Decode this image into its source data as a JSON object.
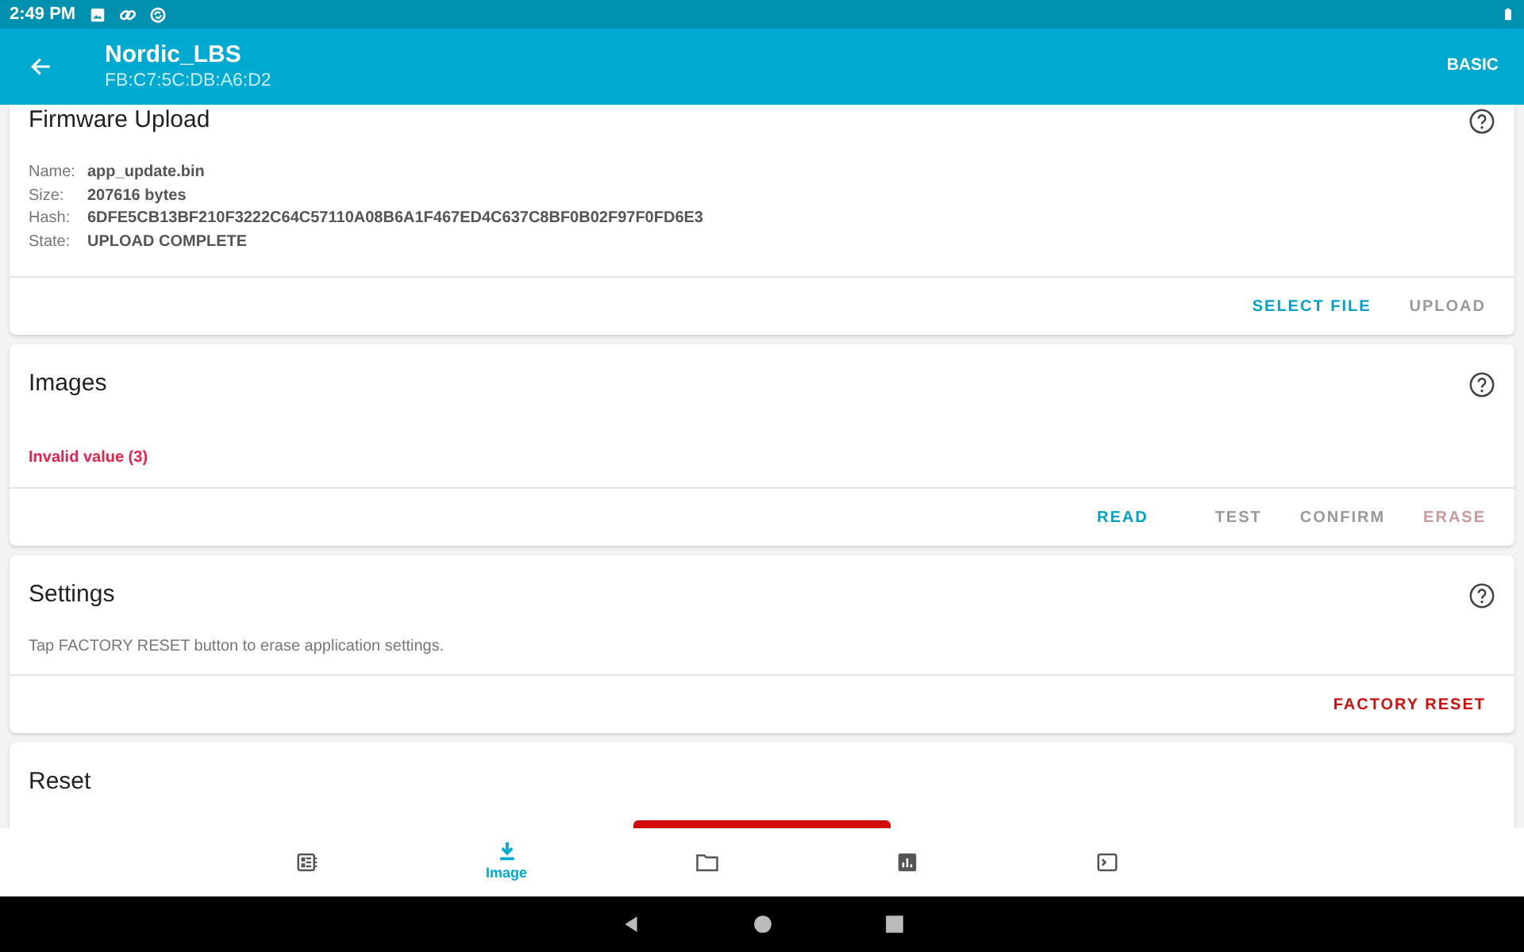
{
  "status_bar": {
    "time": "2:49 PM"
  },
  "app_bar": {
    "title": "Nordic_LBS",
    "subtitle": "FB:C7:5C:DB:A6:D2",
    "action": "BASIC"
  },
  "cards": [
    {
      "title": "Firmware Upload",
      "help": true,
      "fields": [
        {
          "label": "Name:",
          "value": "app_update.bin"
        },
        {
          "label": "Size:",
          "value": "207616 bytes"
        },
        {
          "label": "Hash:",
          "value": "6DFE5CB13BF210F3222C64C57110A08B6A1F467ED4C637C8BF0B02F97F0FD6E3"
        },
        {
          "label": "State:",
          "value": "UPLOAD COMPLETE"
        }
      ],
      "actions": [
        {
          "label": "SELECT FILE",
          "kind": "primary",
          "disabled": false
        },
        {
          "label": "UPLOAD",
          "kind": "primary",
          "disabled": true
        }
      ]
    },
    {
      "title": "Images",
      "help": true,
      "error": "Invalid value (3)",
      "actions": [
        {
          "label": "READ",
          "kind": "primary",
          "disabled": false
        },
        {
          "label": "TEST",
          "kind": "primary",
          "disabled": true
        },
        {
          "label": "CONFIRM",
          "kind": "primary",
          "disabled": true
        },
        {
          "label": "ERASE",
          "kind": "danger",
          "disabled": true
        }
      ]
    },
    {
      "title": "Settings",
      "help": true,
      "text": "Tap FACTORY RESET button to erase application settings.",
      "actions": [
        {
          "label": "FACTORY RESET",
          "kind": "danger",
          "disabled": false
        }
      ]
    },
    {
      "title": "Reset",
      "help": false,
      "big_button": true
    }
  ],
  "bottom_nav": [
    {
      "kind": "device",
      "selected": false
    },
    {
      "kind": "image",
      "label": "Image",
      "selected": true
    },
    {
      "kind": "files",
      "selected": false
    },
    {
      "kind": "stats",
      "selected": false
    },
    {
      "kind": "logs",
      "selected": false
    }
  ]
}
